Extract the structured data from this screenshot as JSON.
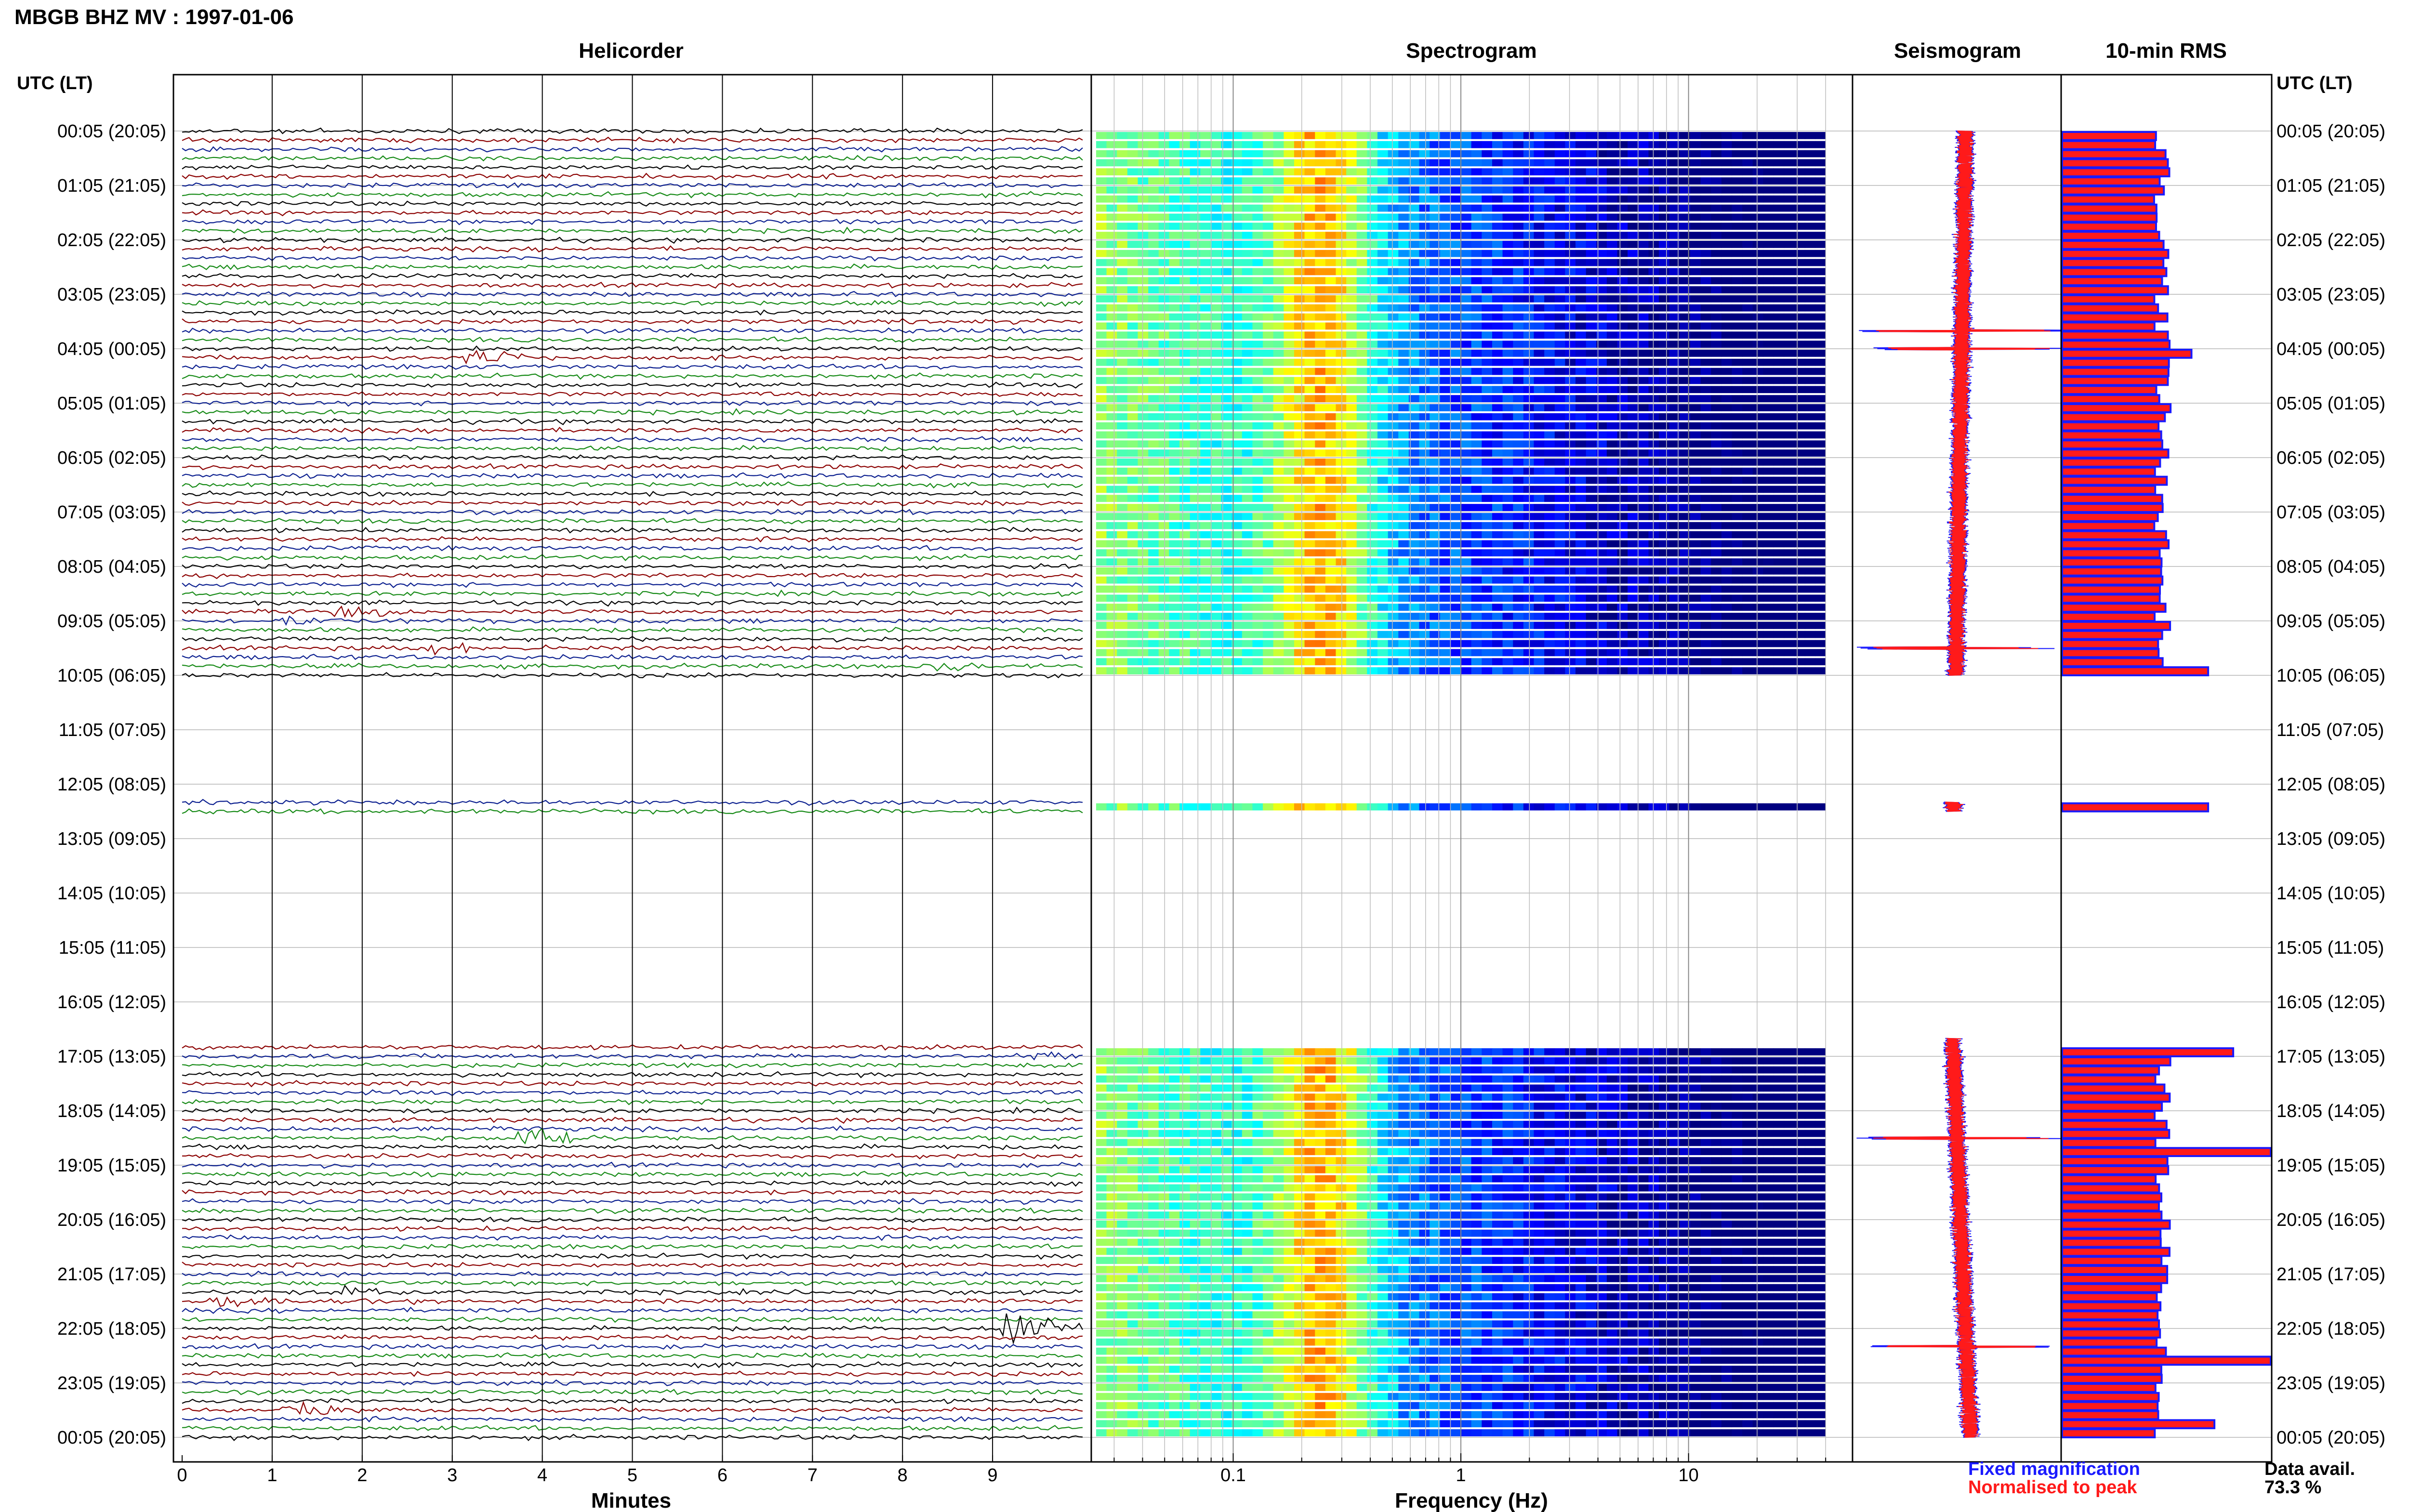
{
  "header": {
    "title": "MBGB BHZ MV : 1997-01-06"
  },
  "chart_data": {
    "type": "seismic-daily-summary",
    "time_axis": {
      "header_left": "UTC (LT)",
      "header_right": "UTC (LT)",
      "row_labels": [
        "00:05 (20:05)",
        "01:05 (21:05)",
        "02:05 (22:05)",
        "03:05 (23:05)",
        "04:05 (00:05)",
        "05:05 (01:05)",
        "06:05 (02:05)",
        "07:05 (03:05)",
        "08:05 (04:05)",
        "09:05 (05:05)",
        "10:05 (06:05)",
        "11:05 (07:05)",
        "12:05 (08:05)",
        "13:05 (09:05)",
        "14:05 (10:05)",
        "15:05 (11:05)",
        "16:05 (12:05)",
        "17:05 (13:05)",
        "18:05 (14:05)",
        "19:05 (15:05)",
        "20:05 (16:05)",
        "21:05 (17:05)",
        "22:05 (18:05)",
        "23:05 (19:05)",
        "00:05 (20:05)"
      ],
      "lines_per_hour": 6,
      "data_segments_utc": [
        [
          0.0,
          10.0
        ],
        [
          12.33,
          12.5
        ],
        [
          16.67,
          24.0
        ]
      ]
    },
    "panels": [
      {
        "name": "Helicorder",
        "type": "line",
        "xlabel": "Minutes",
        "x_ticks": [
          "0",
          "1",
          "2",
          "3",
          "4",
          "5",
          "6",
          "7",
          "8",
          "9"
        ],
        "xlim": [
          0,
          10
        ],
        "trace_colors": [
          "#000000",
          "#8b0000",
          "#0b1f8f",
          "#168a16"
        ],
        "events": [
          {
            "hour": 4.17,
            "minute": 3.2,
            "color": "#000000",
            "amp": 2.2
          },
          {
            "hour": 8.83,
            "minute": 1.8,
            "color": "#0b1f8f",
            "amp": 1.6
          },
          {
            "hour": 9.0,
            "minute": 1.2,
            "color": "#000000",
            "amp": 1.2
          },
          {
            "hour": 9.5,
            "minute": 2.8,
            "color": "#168a16",
            "amp": 1.5
          },
          {
            "hour": 9.83,
            "minute": 8.4,
            "color": "#8b0000",
            "amp": 1.5
          },
          {
            "hour": 17.0,
            "minute": 9.3,
            "color": "#8b0000",
            "amp": 1.4
          },
          {
            "hour": 18.5,
            "minute": 3.8,
            "color": "#168a16",
            "amp": 3.0
          },
          {
            "hour": 21.33,
            "minute": 1.8,
            "color": "#168a16",
            "amp": 1.3
          },
          {
            "hour": 21.5,
            "minute": 0.4,
            "color": "#8b0000",
            "amp": 1.4
          },
          {
            "hour": 22.0,
            "minute": 9.2,
            "color": "#0b1f8f",
            "amp": 3.2
          },
          {
            "hour": 23.5,
            "minute": 1.2,
            "color": "#8b0000",
            "amp": 1.8
          }
        ]
      },
      {
        "name": "Spectrogram",
        "type": "heatmap",
        "xlabel": "Frequency (Hz)",
        "x_scale": "log",
        "x_ticks": [
          "0.1",
          "1",
          "10"
        ],
        "xlim": [
          0.025,
          50
        ],
        "data_xlim": [
          0.025,
          40
        ],
        "colormap": "jet",
        "peak_band_hz": [
          0.15,
          0.4
        ],
        "notes": "energy concentrated near 0.2-0.3 Hz; low power above ~3 Hz"
      },
      {
        "name": "Seismogram",
        "type": "line",
        "series": [
          {
            "name": "Fixed magnification",
            "color": "#1a1aff"
          },
          {
            "name": "Normalised to peak",
            "color": "#ff1a1a"
          }
        ],
        "spikes_hour": [
          3.67,
          4.0,
          9.5,
          18.5,
          22.33
        ]
      },
      {
        "name": "10-min RMS",
        "type": "bar",
        "orientation": "horizontal",
        "bar_fill": "#ff1a1a",
        "bar_edge": "#1a1aff",
        "spike_rows": [
          {
            "hour": 4.0,
            "value": 0.62
          },
          {
            "hour": 9.83,
            "value": 0.7
          },
          {
            "hour": 12.33,
            "value": 0.7
          },
          {
            "hour": 16.83,
            "value": 0.82
          },
          {
            "hour": 18.67,
            "value": 1.0
          },
          {
            "hour": 22.5,
            "value": 1.0
          },
          {
            "hour": 23.67,
            "value": 0.73
          }
        ],
        "baseline_value": 0.48
      }
    ],
    "legend": {
      "fixed": "Fixed magnification",
      "normalised": "Normalised to peak"
    },
    "data_availability": {
      "label": "Data avail.",
      "value": "73.3 %"
    },
    "colors": {
      "fixed_magnification": "#1a1aff",
      "normalised": "#ff1a1a",
      "gap_line": "#888888",
      "frame": "#000000"
    }
  }
}
